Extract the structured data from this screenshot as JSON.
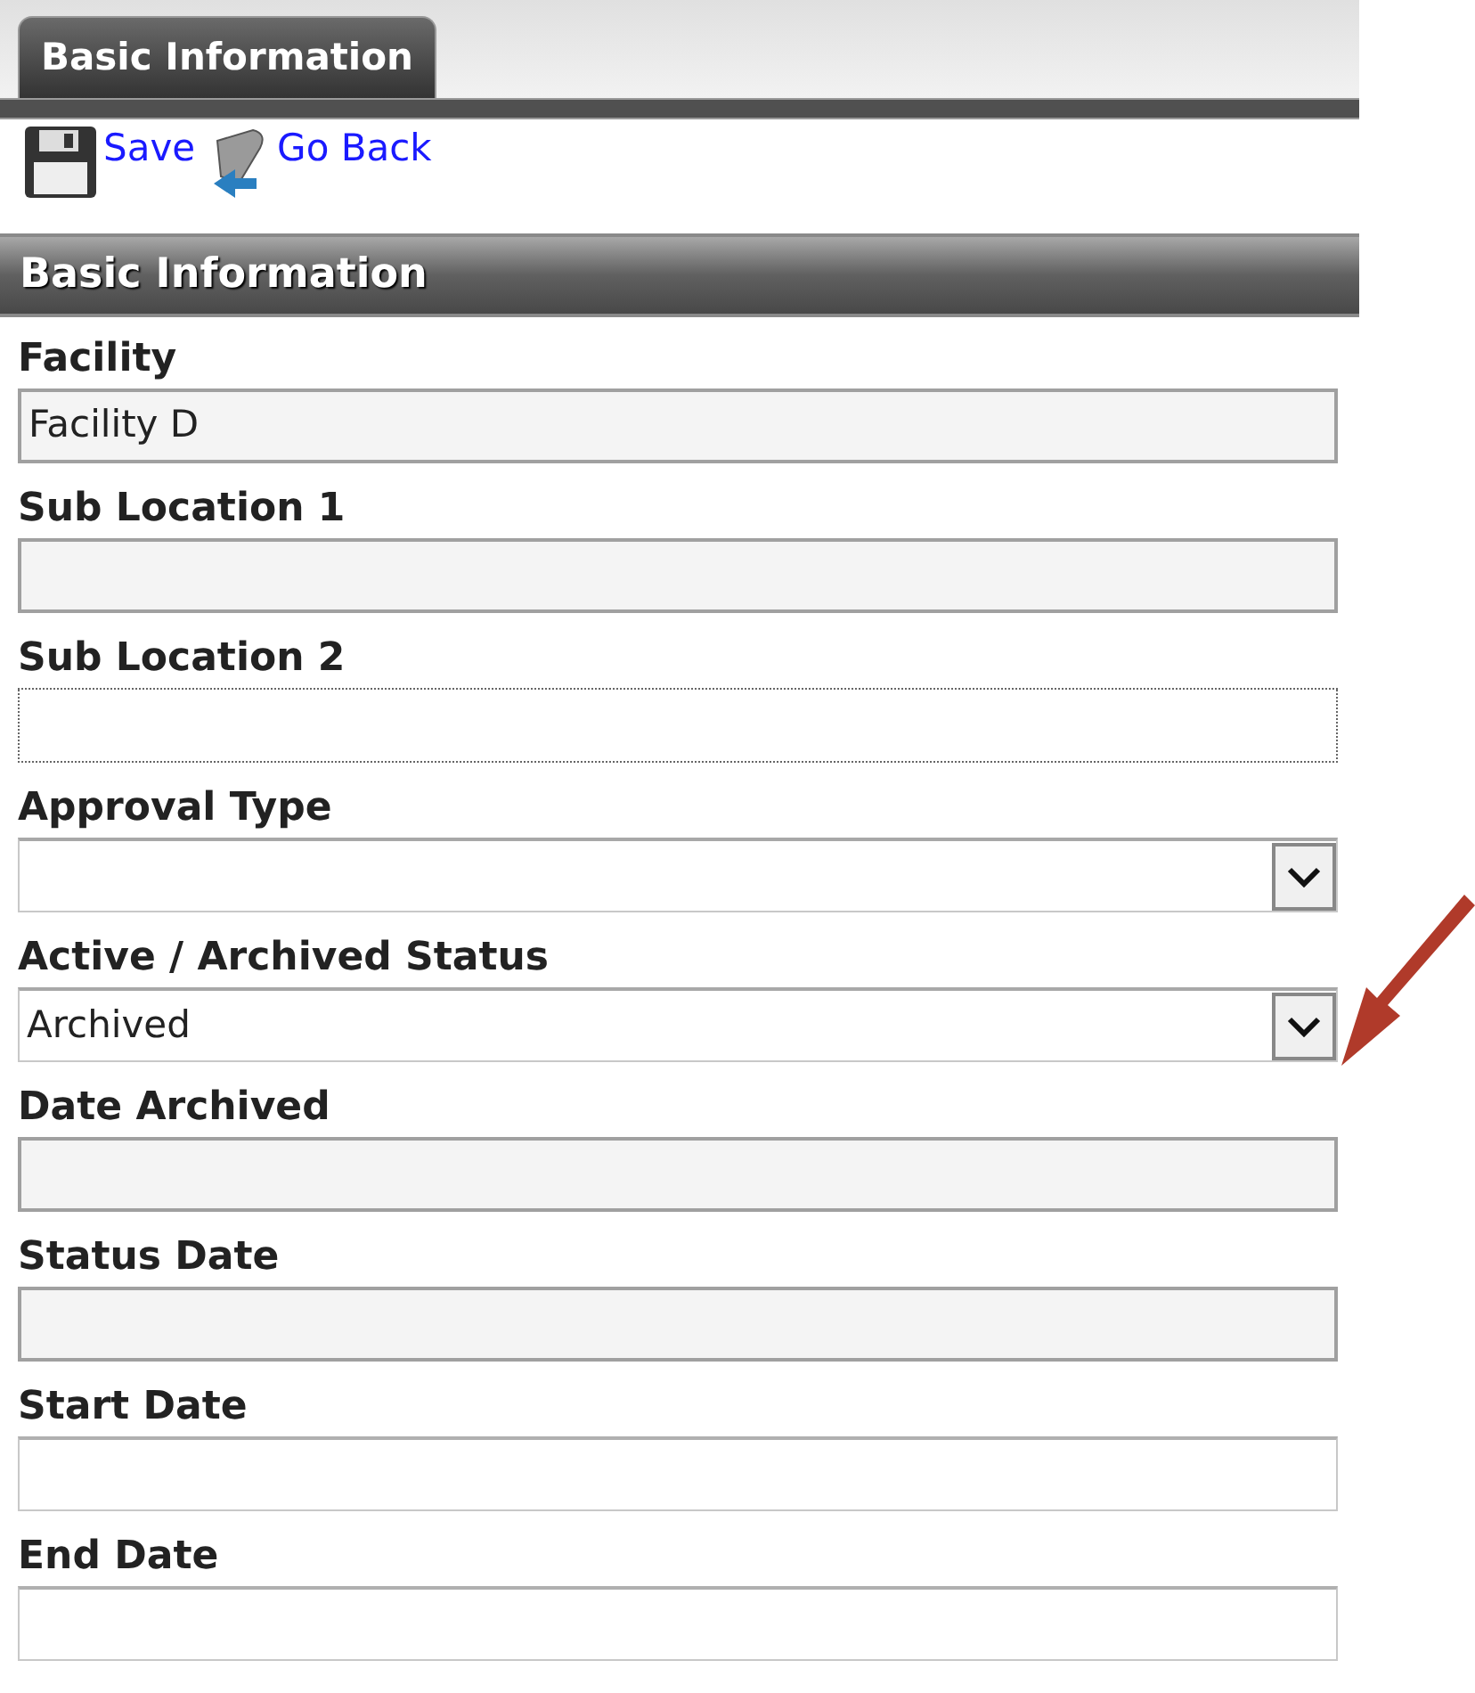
{
  "tabs": [
    {
      "label": "Basic Information",
      "selected": true
    }
  ],
  "toolbar": [
    {
      "kind": "save",
      "label": "Save"
    },
    {
      "kind": "back",
      "label": "Go Back"
    }
  ],
  "section": {
    "title": "Basic Information"
  },
  "fields": [
    {
      "label": "Facility",
      "kind": "readonly",
      "value": "Facility D"
    },
    {
      "label": "Sub Location 1",
      "kind": "readonly"
    },
    {
      "label": "Sub Location 2",
      "kind": "focused"
    },
    {
      "label": "Approval Type",
      "kind": "select"
    },
    {
      "label": "Active / Archived Status",
      "kind": "select",
      "value": "Archived"
    },
    {
      "label": "Date Archived",
      "kind": "readonly"
    },
    {
      "label": "Status Date",
      "kind": "readonly"
    },
    {
      "label": "Start Date",
      "kind": "text"
    },
    {
      "label": "End Date",
      "kind": "text"
    }
  ]
}
